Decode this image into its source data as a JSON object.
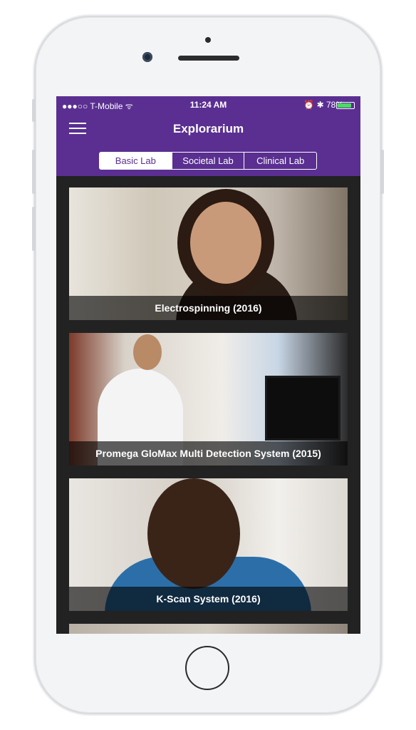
{
  "status_bar": {
    "carrier": "●●●○○ T-Mobile ",
    "wifi_icon": "wifi-icon",
    "time": "11:24 AM",
    "right_icons": "⏰ ✱ ",
    "battery_percent": "78%",
    "battery_level": 0.78,
    "charging": true
  },
  "navbar": {
    "title": "Explorarium",
    "menu_icon": "hamburger-menu-icon",
    "color": "#5a2f91"
  },
  "tabs": [
    {
      "label": "Basic Lab",
      "selected": true
    },
    {
      "label": "Societal Lab",
      "selected": false
    },
    {
      "label": "Clinical Lab",
      "selected": false
    }
  ],
  "videos": [
    {
      "caption": "Electrospinning (2016)"
    },
    {
      "caption": "Promega GloMax Multi Detection System (2015)"
    },
    {
      "caption": "K-Scan System (2016)"
    }
  ]
}
